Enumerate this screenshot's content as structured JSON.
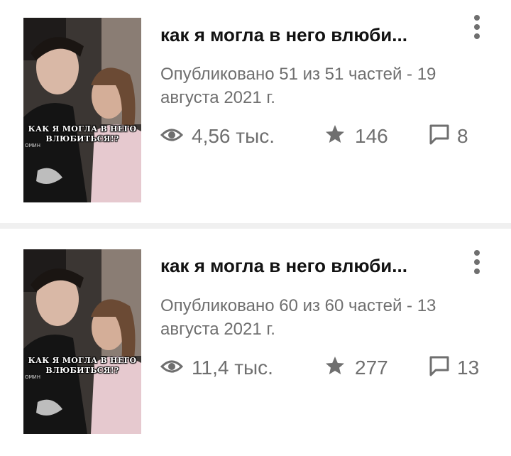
{
  "stories": [
    {
      "cover": {
        "caption_line1": "КАК Я МОГЛА В НЕГО",
        "caption_line2": "ВЛЮБИТЬСЯ!?",
        "side_text": "ОМИН"
      },
      "title": "как я могла в него влюби...",
      "meta": "Опубликовано 51 из 51 частей - 19 августа 2021 г.",
      "stats": {
        "views": "4,56 тыс.",
        "votes": "146",
        "comments": "8"
      }
    },
    {
      "cover": {
        "caption_line1": "КАК Я МОГЛА В НЕГО",
        "caption_line2": "ВЛЮБИТЬСЯ!?",
        "side_text": "ОМИН"
      },
      "title": "как я могла в него влюби...",
      "meta": "Опубликовано 60 из 60 частей - 13 августа 2021 г.",
      "stats": {
        "views": "11,4 тыс.",
        "votes": "277",
        "comments": "13"
      }
    }
  ],
  "icons": {
    "views": "eye-icon",
    "votes": "star-icon",
    "comments": "comment-icon",
    "menu": "more-vertical-icon"
  },
  "colors": {
    "title": "#121212",
    "secondary": "#6f6f6f",
    "card": "#ffffff",
    "divider": "#f0f0f0"
  }
}
